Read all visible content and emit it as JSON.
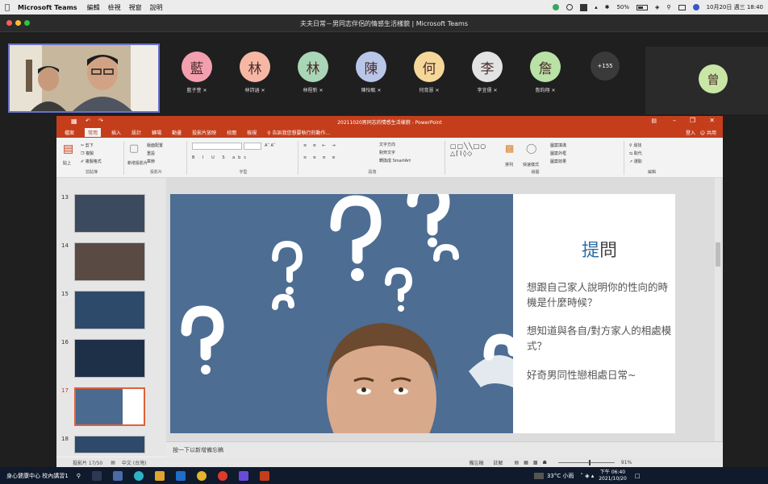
{
  "menubar": {
    "app": "Microsoft Teams",
    "menus": [
      "編輯",
      "檢視",
      "視窗",
      "說明"
    ],
    "battery": "50%",
    "datetime": "10月20日 週三 18:40"
  },
  "window": {
    "title": "夫夫日常－男同志伴侶的情感生活樣貌 | Microsoft Teams"
  },
  "participants": [
    {
      "char": "藍",
      "name": "藍子萱",
      "color": "#f2a0b0"
    },
    {
      "char": "林",
      "name": "林詩涵",
      "color": "#f6b8a4"
    },
    {
      "char": "林",
      "name": "林程新",
      "color": "#a9d6b6"
    },
    {
      "char": "陳",
      "name": "陳怡甄",
      "color": "#b8c6e8"
    },
    {
      "char": "何",
      "name": "何育慧",
      "color": "#f6d79a"
    },
    {
      "char": "李",
      "name": "李宜儒",
      "color": "#e3e3e3"
    },
    {
      "char": "詹",
      "name": "詹鈞翔",
      "color": "#b9e3a6"
    }
  ],
  "more_count": "+155",
  "right_participant": {
    "char": "曾",
    "color": "#c9e6a6"
  },
  "ppt": {
    "file_title": "20211020男同志的情感生活樣貌 - PowerPoint",
    "tabs": [
      "檔案",
      "常用",
      "插入",
      "設計",
      "轉場",
      "動畫",
      "投影片放映",
      "校閱",
      "檢視"
    ],
    "tell_me": "告訴我您想要執行的動作...",
    "account": "登入",
    "share": "共用",
    "ribbon_groups": [
      "剪貼簿",
      "投影片",
      "字型",
      "段落",
      "繪圖",
      "編輯"
    ],
    "ribbon_items": {
      "cut": "剪下",
      "copy": "複製",
      "paste": "貼上",
      "format_painter": "複製格式",
      "new_slide": "新增投影片",
      "layout": "版面配置",
      "reset": "重設",
      "section": "章節",
      "text_direction": "文字方向",
      "align_text": "對齊文字",
      "smartart": "轉換成 SmartArt",
      "arrange": "排列",
      "quick_styles": "快速樣式",
      "shape_fill": "圖案填滿",
      "shape_outline": "圖案外框",
      "shape_effects": "圖案效果",
      "find": "尋找",
      "replace": "取代",
      "select": "選取"
    },
    "slides": [
      "13",
      "14",
      "15",
      "16",
      "17",
      "18"
    ],
    "current_slide": {
      "heading_blue": "提",
      "heading_dark": "問",
      "paragraphs": [
        "想跟自己家人說明你的性向的時機是什麼時候？",
        "想知道與各自/對方家人的相處模式？",
        "好奇男同性戀相處日常~"
      ]
    },
    "notes_placeholder": "按一下以新增備忘稿",
    "status": {
      "slide_count": "投影片 17/50",
      "language": "中文 (台灣)",
      "notes_btn": "備忘稿",
      "comments_btn": "註解",
      "zoom": "91%"
    }
  },
  "taskbar": {
    "label": "身心健康中心 校內講習1",
    "weather": "33°C 小雨",
    "time": "下午 06:40",
    "date": "2021/10/20"
  }
}
